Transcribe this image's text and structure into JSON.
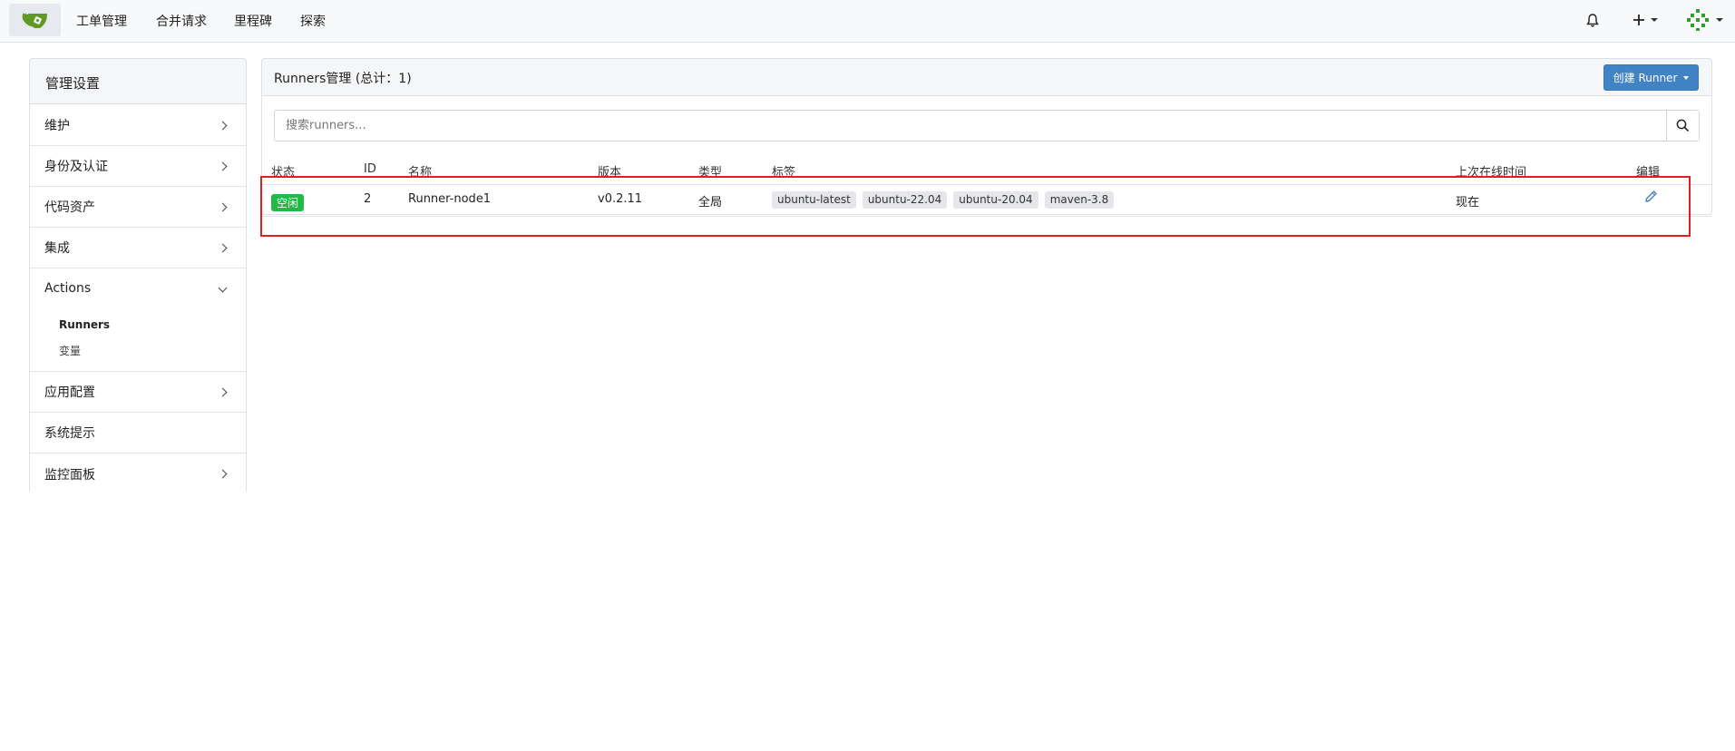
{
  "nav": {
    "items": [
      "工单管理",
      "合并请求",
      "里程碑",
      "探索"
    ]
  },
  "sidebar": {
    "title": "管理设置",
    "items": {
      "maintenance": "维护",
      "identity": "身份及认证",
      "code_assets": "代码资产",
      "integrations": "集成",
      "actions": "Actions",
      "app_config": "应用配置",
      "notices": "系统提示",
      "monitor": "监控面板"
    },
    "actions_sub": {
      "runners": "Runners",
      "variables": "变量"
    }
  },
  "main": {
    "title": "Runners管理 (总计：1)",
    "create_button": "创建 Runner",
    "search_placeholder": "搜索runners...",
    "columns": {
      "status": "状态",
      "id": "ID",
      "name": "名称",
      "version": "版本",
      "type": "类型",
      "labels": "标签",
      "last_online": "上次在线时间",
      "edit": "编辑"
    },
    "rows": [
      {
        "status": "空闲",
        "id": "2",
        "name": "Runner-node1",
        "version": "v0.2.11",
        "type": "全局",
        "labels": [
          "ubuntu-latest",
          "ubuntu-22.04",
          "ubuntu-20.04",
          "maven-3.8"
        ],
        "last_online": "现在"
      }
    ]
  },
  "colors": {
    "accent": "#4183c4",
    "status_idle": "#21ba45",
    "highlight": "#e02020"
  }
}
